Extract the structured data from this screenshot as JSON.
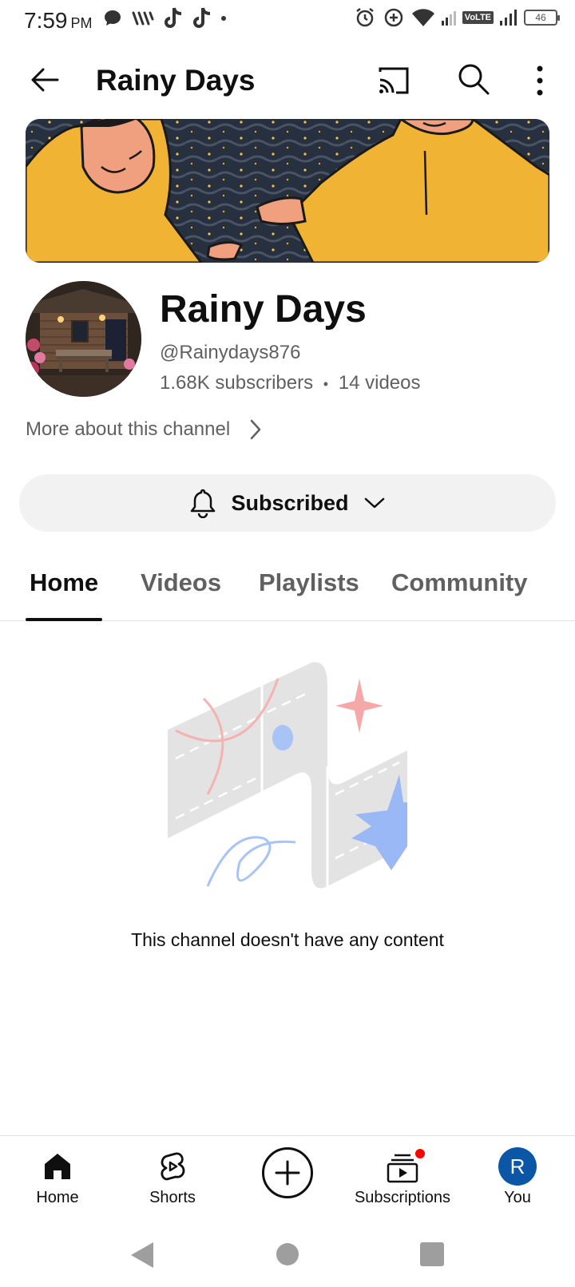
{
  "status_bar": {
    "time": "7:59",
    "ampm": "PM",
    "volte": "VoLTE",
    "battery": "46"
  },
  "app_bar": {
    "title": "Rainy Days",
    "icons": [
      "back-arrow-icon",
      "cast-icon",
      "search-icon",
      "more-vert-icon"
    ]
  },
  "channel": {
    "name": "Rainy Days",
    "handle": "@Rainydays876",
    "subscribers": "1.68K subscribers",
    "separator": "•",
    "videos": "14 videos",
    "more_about": "More about this channel"
  },
  "subscribe_button": {
    "label": "Subscribed"
  },
  "tabs": [
    {
      "label": "Home",
      "active": true
    },
    {
      "label": "Videos",
      "active": false
    },
    {
      "label": "Playlists",
      "active": false
    },
    {
      "label": "Community",
      "active": false
    }
  ],
  "empty_state": {
    "message": "This channel doesn't have any content"
  },
  "bottom_nav": {
    "items": [
      {
        "label": "Home",
        "icon": "home-icon"
      },
      {
        "label": "Shorts",
        "icon": "shorts-icon"
      },
      {
        "label": "",
        "icon": "create-icon"
      },
      {
        "label": "Subscriptions",
        "icon": "subscriptions-icon"
      },
      {
        "label": "You",
        "icon": "avatar",
        "avatar_letter": "R"
      }
    ]
  },
  "colors": {
    "accent": "#0f0f0f",
    "secondary_text": "#606060",
    "notification_dot": "#ff0000",
    "avatar_bg": "#0b57a5",
    "banner_yellow": "#f1b334"
  }
}
